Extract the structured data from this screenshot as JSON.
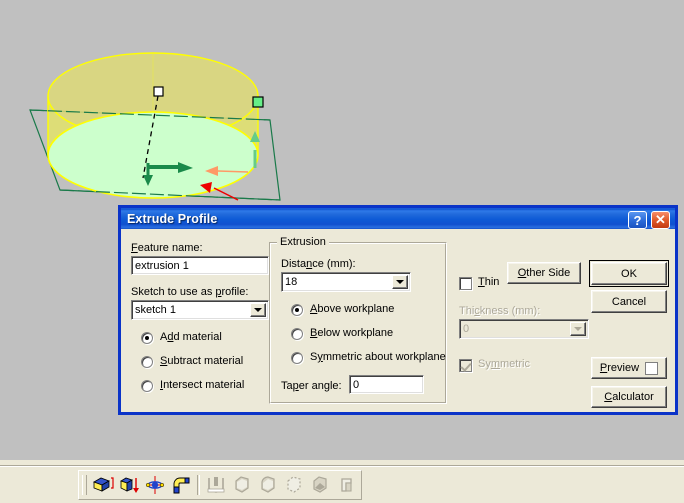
{
  "window": {
    "title": "Extrude Profile",
    "help_button": "?",
    "close_button": "✕"
  },
  "dialog": {
    "feature_name_label": "Feature name:",
    "feature_name_value": "extrusion 1",
    "sketch_label": "Sketch to use as profile:",
    "sketch_value": "sketch 1",
    "material_options": [
      {
        "label": "Add material",
        "selected": true
      },
      {
        "label": "Subtract material",
        "selected": false
      },
      {
        "label": "Intersect material",
        "selected": false
      }
    ],
    "extrusion_group_title": "Extrusion",
    "distance_label": "Distance (mm):",
    "distance_value": "18",
    "direction_options": [
      {
        "label": "Above workplane",
        "selected": true
      },
      {
        "label": "Below workplane",
        "selected": false
      },
      {
        "label": "Symmetric about workplane",
        "selected": false
      }
    ],
    "taper_label": "Taper angle:",
    "taper_value": "0",
    "thin_label": "Thin",
    "thin_checked": false,
    "thickness_label": "Thickness (mm):",
    "thickness_value": "0",
    "thickness_enabled": false,
    "symmetric_label": "Symmetric",
    "symmetric_checked": true,
    "symmetric_enabled": false,
    "buttons": {
      "other_side": "Other Side",
      "ok": "OK",
      "cancel": "Cancel",
      "preview": "Preview",
      "preview_checked": true,
      "calculator": "Calculator"
    }
  },
  "toolbar": {
    "buttons": [
      {
        "name": "extrude-profile-icon",
        "enabled": true
      },
      {
        "name": "extrude-face-icon",
        "enabled": true
      },
      {
        "name": "revolve-profile-icon",
        "enabled": true
      },
      {
        "name": "sweep-profile-icon",
        "enabled": true
      },
      {
        "name": "loft-icon",
        "enabled": false
      },
      {
        "name": "blend-icon",
        "enabled": false
      },
      {
        "name": "fillet-icon",
        "enabled": false
      },
      {
        "name": "chamfer-icon",
        "enabled": false
      },
      {
        "name": "draft-icon",
        "enabled": false
      },
      {
        "name": "shell-icon",
        "enabled": false
      }
    ]
  },
  "viewport": {
    "background_color": "#c0c0c0",
    "solid_fill_color": "#dddd77",
    "profile_fill_color": "#ccffcc",
    "edge_color": "#ffff00",
    "workplane_color": "#1a7a4a",
    "axis_color": "#000000",
    "handle_fill_color": "#66ee88",
    "arrow_green_color": "#1a8a4a",
    "arrow_orange_color": "#ff9966",
    "arrow_red_color": "#ee0000"
  }
}
